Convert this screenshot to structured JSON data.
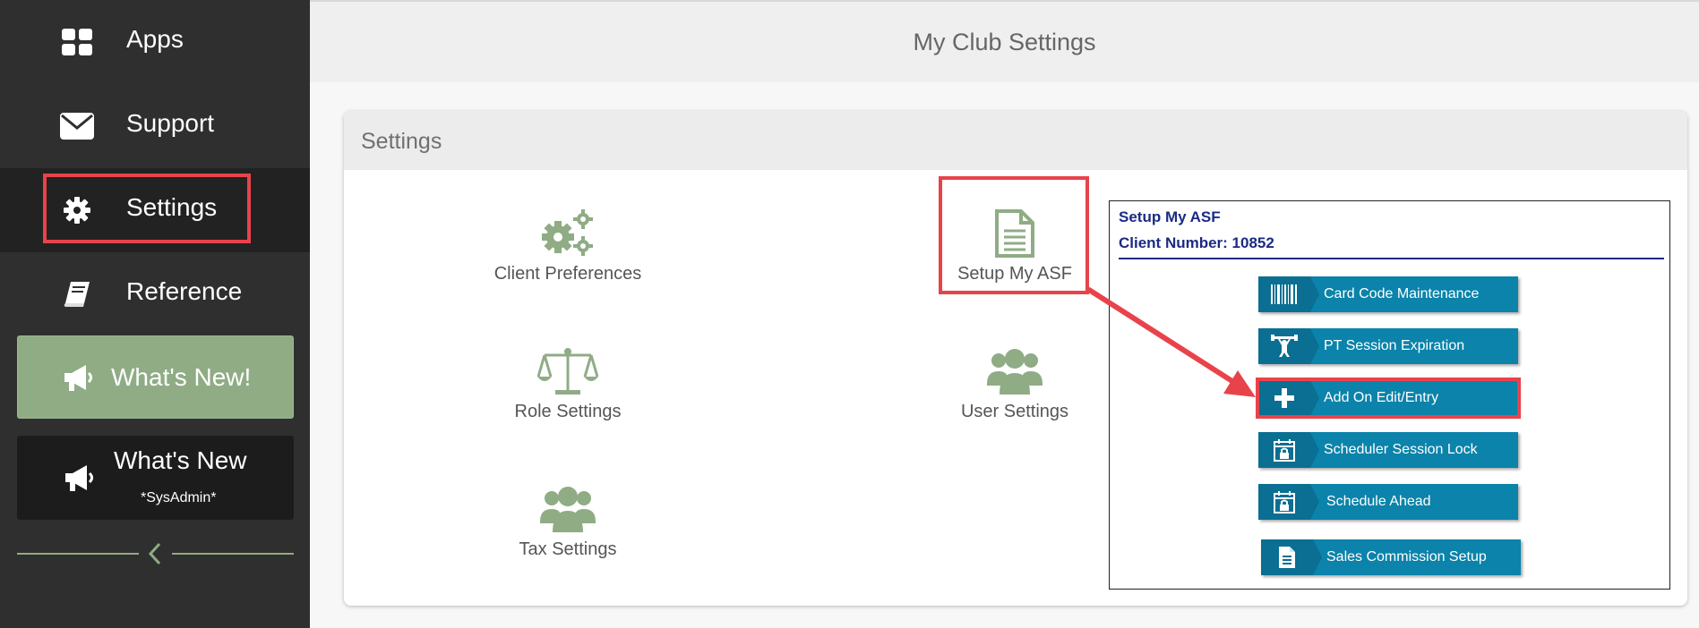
{
  "sidebar": {
    "items": [
      {
        "label": "Apps",
        "icon": "apps-grid-icon"
      },
      {
        "label": "Support",
        "icon": "envelope-icon"
      },
      {
        "label": "Settings",
        "icon": "gear-icon"
      },
      {
        "label": "Reference",
        "icon": "book-icon"
      }
    ],
    "whats_new_label": "What's New!",
    "whats_new_sys_title": "What's New",
    "whats_new_sys_sub": "*SysAdmin*",
    "collapse_icon": "chevron-left-icon"
  },
  "header": {
    "title": "My Club Settings"
  },
  "panel": {
    "title": "Settings",
    "tiles": [
      {
        "label": "Client Preferences",
        "icon": "gears-icon"
      },
      {
        "label": "Setup My ASF",
        "icon": "document-icon"
      },
      {
        "label": "Role Settings",
        "icon": "balance-scale-icon"
      },
      {
        "label": "User Settings",
        "icon": "users-icon"
      },
      {
        "label": "Tax Settings",
        "icon": "users-icon"
      }
    ]
  },
  "setup_popup": {
    "heading": "Setup My ASF",
    "client_number": "Client Number: 10852",
    "buttons": [
      {
        "label": "Card Code Maintenance",
        "icon": "barcode-icon"
      },
      {
        "label": "PT Session Expiration",
        "icon": "weightlifter-icon"
      },
      {
        "label": "Add On Edit/Entry",
        "icon": "plus-icon"
      },
      {
        "label": "Scheduler Session Lock",
        "icon": "calendar-lock-icon"
      },
      {
        "label": "Schedule Ahead",
        "icon": "calendar-lock-icon"
      },
      {
        "label": "Sales Commission Setup",
        "icon": "document-icon"
      }
    ]
  },
  "colors": {
    "sidebar_bg": "#2f2f2f",
    "accent_green": "#8fac85",
    "button_blue": "#0b83aa",
    "highlight_red": "#e8434b",
    "popup_text_navy": "#1b2a85"
  }
}
